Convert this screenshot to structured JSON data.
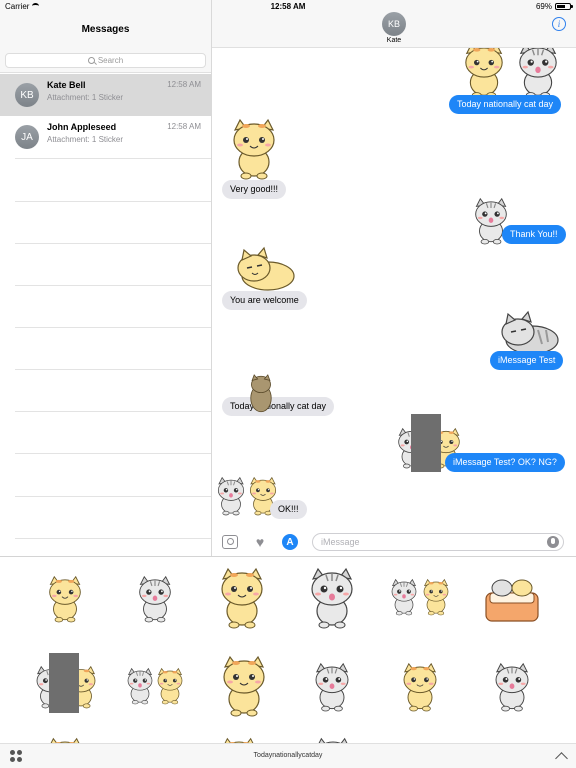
{
  "status_bar": {
    "carrier": "Carrier",
    "time": "12:58 AM",
    "battery": "69%",
    "battery_level": 0.69
  },
  "sidebar": {
    "title": "Messages",
    "search_placeholder": "Search",
    "conversations": [
      {
        "initials": "KB",
        "name": "Kate Bell",
        "preview": "Attachment: 1 Sticker",
        "time": "12:58 AM",
        "selected": true
      },
      {
        "initials": "JA",
        "name": "John Appleseed",
        "preview": "Attachment: 1 Sticker",
        "time": "12:58 AM",
        "selected": false
      }
    ]
  },
  "chat": {
    "contact_initials": "KB",
    "contact_name": "Kate",
    "info_icon": "info-icon",
    "messages": [
      {
        "text": "Today nationally cat day",
        "direction": "out"
      },
      {
        "text": "Very good!!!",
        "direction": "in"
      },
      {
        "text": "Thank You!!",
        "direction": "out"
      },
      {
        "text": "You are welcome",
        "direction": "in"
      },
      {
        "text": "iMessage Test",
        "direction": "out"
      },
      {
        "text": "Today nationally cat day",
        "direction": "in"
      },
      {
        "text": "iMessage Test? OK? NG?",
        "direction": "out"
      },
      {
        "text": "OK!!!",
        "direction": "in"
      }
    ]
  },
  "input_bar": {
    "placeholder": "iMessage",
    "icons": [
      "camera-icon",
      "heart-icon",
      "app-store-icon",
      "microphone-icon"
    ]
  },
  "drawer": {
    "footer_label": "Todaynationallycatday",
    "icons": [
      "app-grid-icon",
      "chevron-up-icon"
    ]
  },
  "colors": {
    "cream_cat": "#fbe49b",
    "gray_cat": "#c9c9c9",
    "bubble_out": "#1e86f7",
    "bubble_in": "#e5e5ea"
  }
}
